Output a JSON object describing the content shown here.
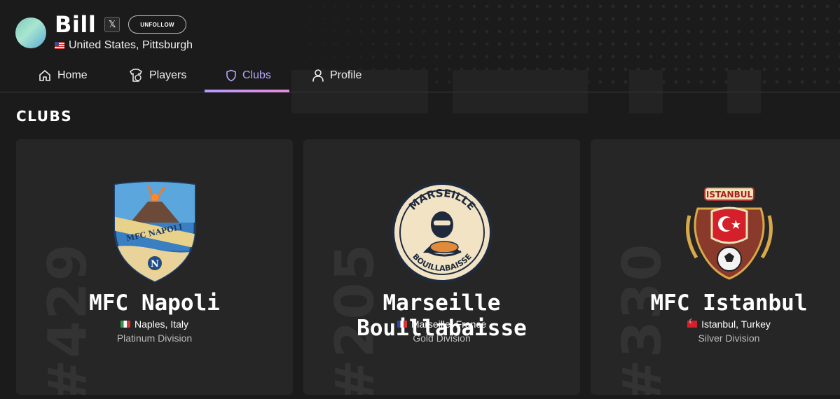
{
  "profile": {
    "username": "Bill",
    "x_icon": "x-logo-icon",
    "unfollow_label": "UNFOLLOW",
    "location": "United States, Pittsburgh",
    "country_flag": "us-flag-icon"
  },
  "tabs": [
    {
      "label": "Home",
      "icon": "home-icon",
      "active": false
    },
    {
      "label": "Players",
      "icon": "players-icon",
      "active": false
    },
    {
      "label": "Clubs",
      "icon": "shield-icon",
      "active": true
    },
    {
      "label": "Profile",
      "icon": "user-icon",
      "active": false
    }
  ],
  "section_title": "CLUBS",
  "clubs": [
    {
      "rank": "#429",
      "name": "MFC Napoli",
      "location": "Naples, Italy",
      "flag": "italy-flag-icon",
      "division": "Platinum Division",
      "crest": "mfc-napoli-crest"
    },
    {
      "rank": "#205",
      "name": "Marseille Bouillabaisse",
      "location": "Marseille, France",
      "flag": "france-flag-icon",
      "division": "Gold Division",
      "crest": "marseille-bouillabaisse-crest"
    },
    {
      "rank": "#330",
      "name": "MFC Istanbul",
      "location": "Istanbul, Turkey",
      "flag": "turkey-flag-icon",
      "division": "Silver Division",
      "crest": "mfc-istanbul-crest"
    }
  ],
  "crest_text": {
    "napoli": "MFC NAPOLI",
    "napoli_letter": "N",
    "marseille_top": "MARSEILLE",
    "marseille_bottom": "BOUILLABAISSE",
    "istanbul": "ISTANBUL"
  },
  "colors": {
    "background": "#1b1b1b",
    "card": "#262626",
    "active_tab": "#b7a8ff",
    "tab_underline_start": "#b59cff",
    "tab_underline_end": "#e98ad8"
  }
}
